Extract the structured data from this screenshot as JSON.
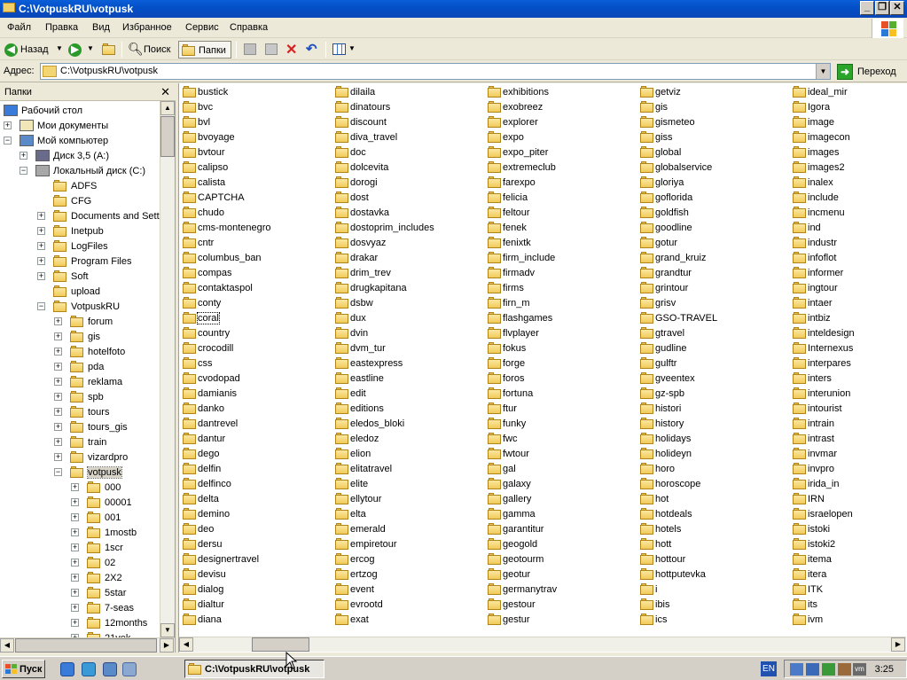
{
  "window": {
    "title": "C:\\VotpuskRU\\votpusk"
  },
  "menu": [
    "Файл",
    "Правка",
    "Вид",
    "Избранное",
    "Сервис",
    "Справка"
  ],
  "toolbar": {
    "back": "Назад",
    "search": "Поиск",
    "folders": "Папки"
  },
  "address": {
    "label": "Адрес:",
    "value": "C:\\VotpuskRU\\votpusk",
    "go": "Переход"
  },
  "folders_pane": {
    "title": "Папки",
    "tree": [
      {
        "label": "Рабочий стол",
        "icon": "desktop-icon"
      },
      {
        "label": "Мои документы",
        "icon": "my-documents-icon"
      },
      {
        "label": "Мой компьютер",
        "icon": "my-computer-icon"
      },
      {
        "label": "Диск 3,5 (A:)",
        "icon": "floppy-icon"
      },
      {
        "label": "Локальный диск (C:)",
        "icon": "hard-disk-icon"
      },
      {
        "label": "ADFS"
      },
      {
        "label": "CFG"
      },
      {
        "label": "Documents and Setti"
      },
      {
        "label": "Inetpub"
      },
      {
        "label": "LogFiles"
      },
      {
        "label": "Program Files"
      },
      {
        "label": "Soft"
      },
      {
        "label": "upload"
      },
      {
        "label": "VotpuskRU"
      },
      {
        "label": "forum"
      },
      {
        "label": "gis"
      },
      {
        "label": "hotelfoto"
      },
      {
        "label": "pda"
      },
      {
        "label": "reklama"
      },
      {
        "label": "spb"
      },
      {
        "label": "tours"
      },
      {
        "label": "tours_gis"
      },
      {
        "label": "train"
      },
      {
        "label": "vizardpro"
      },
      {
        "label": "votpusk"
      },
      {
        "label": "000"
      },
      {
        "label": "00001"
      },
      {
        "label": "001"
      },
      {
        "label": "1mostb"
      },
      {
        "label": "1scr"
      },
      {
        "label": "02"
      },
      {
        "label": "2X2"
      },
      {
        "label": "5star"
      },
      {
        "label": "7-seas"
      },
      {
        "label": "12months"
      },
      {
        "label": "21vek"
      }
    ]
  },
  "content": {
    "columns": [
      [
        "bustick",
        "bvc",
        "bvl",
        "bvoyage",
        "bvtour",
        "calipso",
        "calista",
        "CAPTCHA",
        "chudo",
        "cms-montenegro",
        "cntr",
        "columbus_ban",
        "compas",
        "contaktaspol",
        "conty",
        "coral",
        "country",
        "crocodill",
        "css",
        "cvodopad",
        "damianis",
        "danko",
        "dantrevel",
        "dantur",
        "dego",
        "delfin",
        "delfinco",
        "delta",
        "demino",
        "deo",
        "dersu",
        "designertravel",
        "devisu",
        "dialog",
        "dialtur",
        "diana"
      ],
      [
        "dilaila",
        "dinatours",
        "discount",
        "diva_travel",
        "doc",
        "dolcevita",
        "dorogi",
        "dost",
        "dostavka",
        "dostoprim_includes",
        "dosvyaz",
        "drakar",
        "drim_trev",
        "drugkapitana",
        "dsbw",
        "dux",
        "dvin",
        "dvm_tur",
        "eastexpress",
        "eastline",
        "edit",
        "editions",
        "eledos_bloki",
        "eledoz",
        "elion",
        "elitatravel",
        "elite",
        "ellytour",
        "elta",
        "emerald",
        "empiretour",
        "ercog",
        "ertzog",
        "event",
        "evrootd",
        "exat"
      ],
      [
        "exhibitions",
        "exobreez",
        "explorer",
        "expo",
        "expo_piter",
        "extremeclub",
        "farexpo",
        "felicia",
        "feltour",
        "fenek",
        "fenixtk",
        "firm_include",
        "firmadv",
        "firms",
        "firn_m",
        "flashgames",
        "flvplayer",
        "fokus",
        "forge",
        "foros",
        "fortuna",
        "ftur",
        "funky",
        "fwc",
        "fwtour",
        "gal",
        "galaxy",
        "gallery",
        "gamma",
        "garantitur",
        "geogold",
        "geotourm",
        "geotur",
        "germanytrav",
        "gestour",
        "gestur"
      ],
      [
        "getviz",
        "gis",
        "gismeteo",
        "giss",
        "global",
        "globalservice",
        "gloriya",
        "goflorida",
        "goldfish",
        "goodline",
        "gotur",
        "grand_kruiz",
        "grandtur",
        "grintour",
        "grisv",
        "GSO-TRAVEL",
        "gtravel",
        "gudline",
        "gulftr",
        "gveentex",
        "gz-spb",
        "histori",
        "history",
        "holidays",
        "holideyn",
        "horo",
        "horoscope",
        "hot",
        "hotdeals",
        "hotels",
        "hott",
        "hottour",
        "hottputevka",
        "i",
        "ibis",
        "ics"
      ],
      [
        "ideal_mir",
        "Igora",
        "image",
        "imagecon",
        "images",
        "images2",
        "inalex",
        "include",
        "incmenu",
        "ind",
        "industr",
        "infoflot",
        "informer",
        "ingtour",
        "intaer",
        "intbiz",
        "inteldesign",
        "Internexus",
        "interpares",
        "inters",
        "interunion",
        "intourist",
        "intrain",
        "intrast",
        "invmar",
        "invpro",
        "irida_in",
        "IRN",
        "israelopen",
        "istoki",
        "istoki2",
        "itema",
        "itera",
        "ITK",
        "its",
        "ivm"
      ]
    ],
    "focused_item": "coral"
  },
  "taskbar": {
    "start": "Пуск",
    "window": "C:\\VotpuskRU\\votpusk",
    "lang": "EN",
    "clock": "3:25"
  }
}
